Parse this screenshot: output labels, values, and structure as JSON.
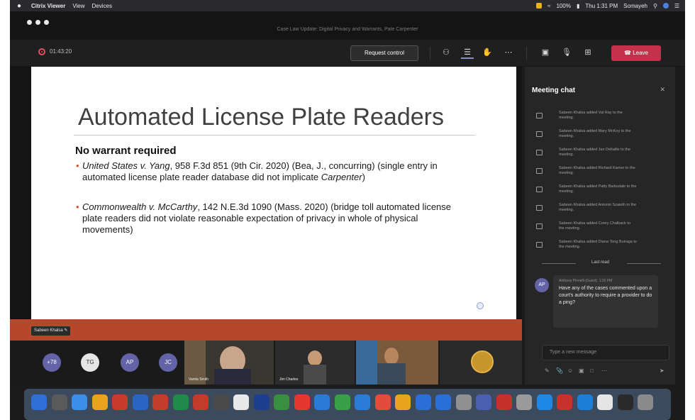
{
  "menubar": {
    "app_name": "Citrix Viewer",
    "menu_view": "View",
    "menu_devices": "Devices",
    "battery": "100%",
    "clock": "Thu 1:31 PM",
    "user": "Somayeh"
  },
  "window": {
    "title": "Case Law Update: Digital Privacy and Warrants, Pate Carpenter"
  },
  "toolbar": {
    "timer": "01:43:20",
    "request_control_label": "Request control",
    "leave_label": "Leave"
  },
  "slide": {
    "title": "Automated License Plate Readers",
    "heading": "No warrant required",
    "bullets": [
      {
        "case": "United States v. Yang",
        "rest": ", 958 F.3d 851 (9th Cir. 2020) (Bea, J., concurring) (single entry in automated license plate reader database did not implicate ",
        "tail": "Carpenter",
        "end": ")"
      },
      {
        "case": "Commonwealth v. McCarthy",
        "rest": ", 142 N.E.3d 1090 (Mass. 2020) (bridge toll automated license plate readers did not violate reasonable expectation of privacy in whole of physical movements)"
      }
    ],
    "presenter_tag": "Sabeen Khalsa"
  },
  "participants": {
    "avatars": [
      {
        "initials": "+78",
        "color": "#6264a7"
      },
      {
        "initials": "TG",
        "color": "#e6e6e6"
      },
      {
        "initials": "AP",
        "color": "#6264a7"
      },
      {
        "initials": "JC",
        "color": "#6264a7"
      }
    ],
    "video_tiles": [
      {
        "label": "Vanita Smith"
      },
      {
        "label": "Jim Charles"
      },
      {
        "label": ""
      },
      {
        "label": ""
      }
    ]
  },
  "chat": {
    "title": "Meeting chat",
    "system_messages": [
      "Sabeen Khalsa added Val Ray to the meeting.",
      "Sabeen Khalsa added Mary McKoy to the meeting.",
      "Sabeen Khalsa added Jan Deltaille to the meeting.",
      "Sabeen Khalsa added Richard Kamer to the meeting.",
      "Sabeen Khalsa added Patty Barksdale to the meeting.",
      "Sabeen Khalsa added Antonio Szaieth to the meeting.",
      "Sabeen Khalsa added Corey Chalback to the meeting.",
      "Sabeen Khalsa added Diana Tong Buiraga to the meeting."
    ],
    "last_read": "Last read",
    "message": {
      "avatar": "AP",
      "author": "Anthony Pinnelli (Guest)",
      "time": "1:20 PM",
      "text": "Have any of the cases commented upon a court's authority to require a provider to do a ping?"
    },
    "compose_placeholder": "Type a new message"
  },
  "dock": {
    "colors": [
      "#2e6fd8",
      "#5a5a5a",
      "#3b8fe8",
      "#e8a21c",
      "#c83a2a",
      "#2c64c5",
      "#c43c2a",
      "#1f8a4a",
      "#c33b2b",
      "#4a4a4a",
      "#e8e8e8",
      "#1d3f8f",
      "#3a8e40",
      "#e5372f",
      "#2a7ad8",
      "#3aa047",
      "#2b7bd8",
      "#e34b3c",
      "#e7a21e",
      "#2b6ed8",
      "#2a6fd8",
      "#909090",
      "#4a5fb0",
      "#c7312c",
      "#9a9a9a",
      "#1e88e5",
      "#c8312c",
      "#1c7ed6",
      "#e5e5e5",
      "#2a2a2a",
      "#8a8a8a"
    ]
  }
}
